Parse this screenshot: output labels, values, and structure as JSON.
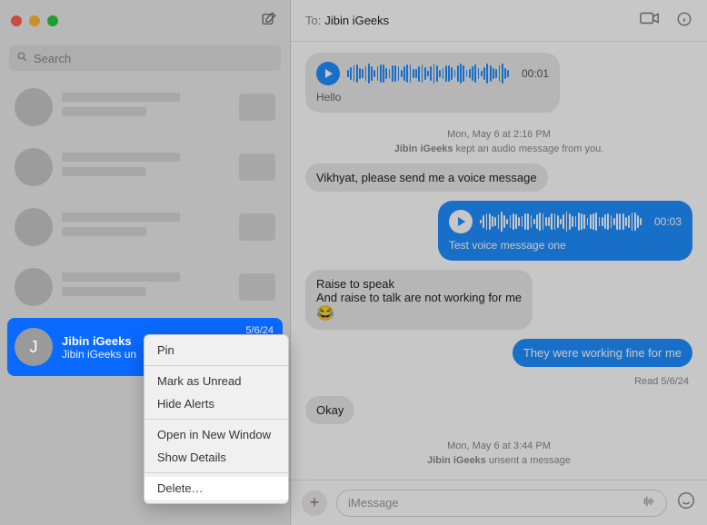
{
  "sidebar": {
    "search_placeholder": "Search",
    "selected": {
      "avatar_initial": "J",
      "name": "Jibin iGeeks",
      "preview": "Jibin iGeeks un",
      "date": "5/6/24"
    }
  },
  "context_menu": {
    "pin": "Pin",
    "mark_unread": "Mark as Unread",
    "hide_alerts": "Hide Alerts",
    "open_new_window": "Open in New Window",
    "show_details": "Show Details",
    "delete": "Delete…"
  },
  "header": {
    "to_label": "To:",
    "recipient": "Jibin iGeeks"
  },
  "thread": {
    "audio1": {
      "duration": "00:01",
      "label": "Hello"
    },
    "ts1": "Mon, May 6 at 2:16 PM",
    "status1_prefix": "Jibin iGeeks",
    "status1_rest": " kept an audio message from you.",
    "msg1": "Vikhyat, please send me a voice message",
    "audio2": {
      "duration": "00:03",
      "label": "Test voice message one"
    },
    "msg2_l1": "Raise to speak",
    "msg2_l2": "And raise to talk are not working for me",
    "msg3": "They were working fine for me",
    "read": "Read 5/6/24",
    "msg4": "Okay",
    "ts2": "Mon, May 6 at 3:44 PM",
    "status2_prefix": "Jibin iGeeks",
    "status2_rest": " unsent a message"
  },
  "composer": {
    "placeholder": "iMessage"
  }
}
